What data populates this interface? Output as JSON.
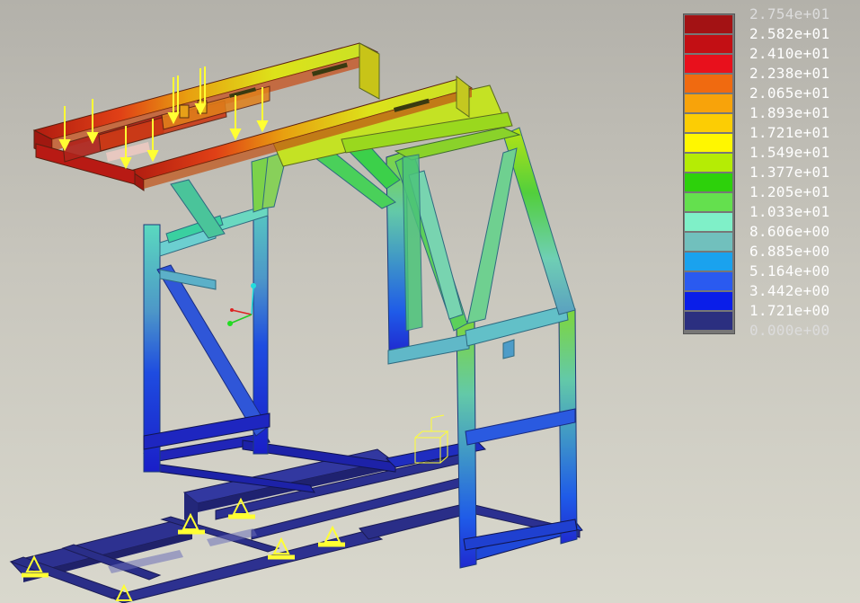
{
  "legend": {
    "labels": [
      "2.754e+01",
      "2.582e+01",
      "2.410e+01",
      "2.238e+01",
      "2.065e+01",
      "1.893e+01",
      "1.721e+01",
      "1.549e+01",
      "1.377e+01",
      "1.205e+01",
      "1.033e+01",
      "8.606e+00",
      "6.885e+00",
      "5.164e+00",
      "3.442e+00",
      "1.721e+00",
      "0.000e+00"
    ],
    "colors": [
      "#a31214",
      "#c30f14",
      "#e8101c",
      "#f06a10",
      "#f8a30a",
      "#fccd04",
      "#fff700",
      "#b5ec05",
      "#2dd10b",
      "#64e04e",
      "#7ff0c8",
      "#71c0bd",
      "#1aa2ee",
      "#2a5af0",
      "#0a1ee9",
      "#2b2f80"
    ]
  }
}
